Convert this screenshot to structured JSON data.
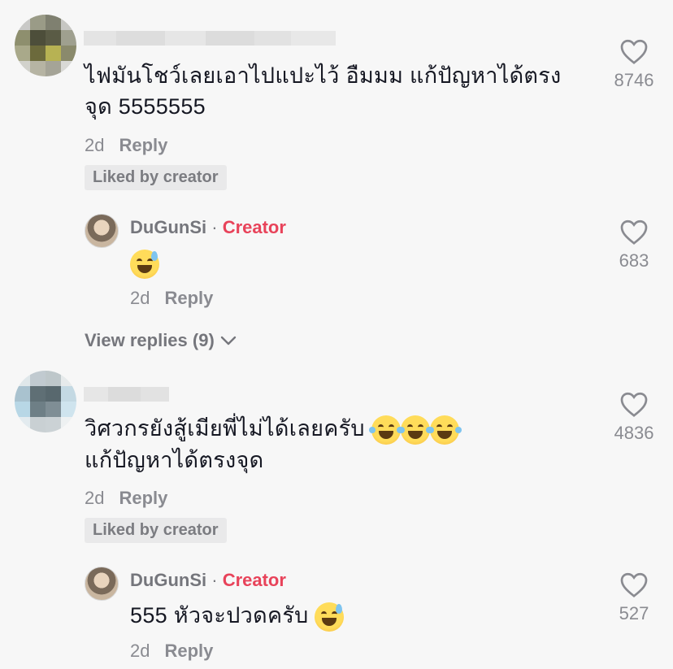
{
  "comments": [
    {
      "text_line1": "ไฟมันโชว์เลยเอาไปแปะไว้ อืมมม แก้ปัญหาได้ตรง",
      "text_line2": "จุด 5555555",
      "time": "2d",
      "reply_label": "Reply",
      "liked_badge": "Liked by creator",
      "likes": "8746",
      "reply": {
        "author": "DuGunSi",
        "separator": "·",
        "creator_badge": "Creator",
        "text": "",
        "time": "2d",
        "reply_label": "Reply",
        "likes": "683"
      },
      "view_replies": "View replies (9)"
    },
    {
      "text_line1": "วิศวกรยังสู้เมียพี่ไม่ได้เลยครับ",
      "text_line2": "แก้ปัญหาได้ตรงจุด",
      "time": "2d",
      "reply_label": "Reply",
      "liked_badge": "Liked by creator",
      "likes": "4836",
      "reply": {
        "author": "DuGunSi",
        "separator": "·",
        "creator_badge": "Creator",
        "text": "555 หัวจะปวดครับ",
        "time": "2d",
        "reply_label": "Reply",
        "likes": "527"
      }
    }
  ],
  "icons": {
    "like": "heart-outline-icon",
    "chevron": "chevron-down-icon",
    "emoji_sweat": "grinning-sweat-emoji",
    "emoji_laugh": "tears-of-joy-emoji"
  },
  "colors": {
    "background": "#f7f7f7",
    "text": "#161823",
    "muted": "#8a8b91",
    "creator": "#e8435a"
  }
}
